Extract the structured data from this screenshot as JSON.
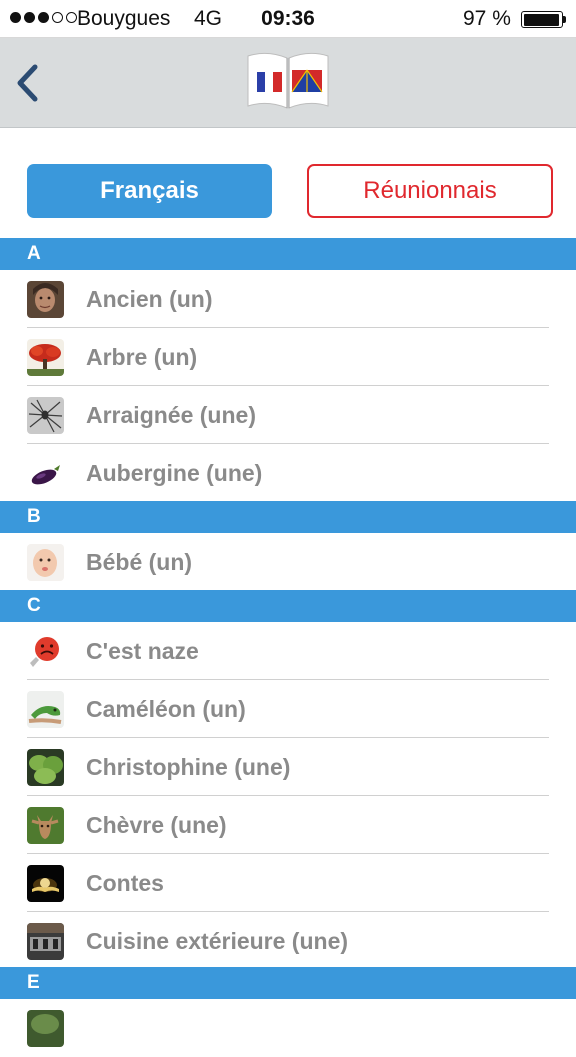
{
  "status_bar": {
    "carrier": "Bouygues",
    "network": "4G",
    "time": "09:36",
    "battery": "97 %",
    "battery_level": 0.97,
    "signal_bars_filled": 3,
    "signal_bars_total": 5
  },
  "navbar": {
    "back_icon": "chevron-left-icon",
    "logo_icon": "open-book-flags-logo",
    "colors": {
      "background": "#d9dcdd",
      "back": "#2b4b72"
    }
  },
  "language_toggle": {
    "francais": "Français",
    "reunionnais": "Réunionnais",
    "selected": "Français",
    "colors": {
      "active": "#3a98db",
      "inactive": "#e0282e"
    }
  },
  "sections": [
    {
      "letter": "A",
      "items": [
        {
          "label": "Ancien (un)",
          "icon": "old-woman-thumbnail"
        },
        {
          "label": "Arbre (un)",
          "icon": "flame-tree-thumbnail"
        },
        {
          "label": "Arraignée (une)",
          "icon": "spider-thumbnail"
        },
        {
          "label": "Aubergine (une)",
          "icon": "eggplant-thumbnail"
        }
      ]
    },
    {
      "letter": "B",
      "items": [
        {
          "label": "Bébé (un)",
          "icon": "baby-thumbnail"
        }
      ]
    },
    {
      "letter": "C",
      "items": [
        {
          "label": "C'est naze",
          "icon": "sad-face-thumbnail"
        },
        {
          "label": "Caméléon (un)",
          "icon": "chameleon-thumbnail"
        },
        {
          "label": "Christophine (une)",
          "icon": "chayote-thumbnail"
        },
        {
          "label": "Chèvre (une)",
          "icon": "goat-thumbnail"
        },
        {
          "label": "Contes",
          "icon": "glowing-book-thumbnail"
        },
        {
          "label": "Cuisine extérieure (une)",
          "icon": "outdoor-kitchen-thumbnail"
        }
      ]
    },
    {
      "letter": "E",
      "items": []
    }
  ]
}
